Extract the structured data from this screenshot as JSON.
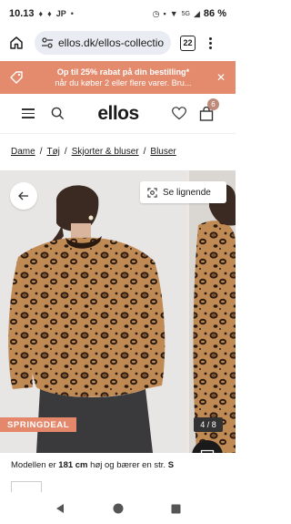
{
  "status": {
    "time": "10.13",
    "carrier": "JP",
    "signal": "5G",
    "battery": "86 %"
  },
  "browser": {
    "url": "ellos.dk/ellos-collectio",
    "tab_count": "22"
  },
  "promo": {
    "line1": "Op til 25% rabat på din bestilling*",
    "line2": "når du køber 2 eller flere varer. Bru..."
  },
  "header": {
    "logo": "ellos",
    "cart_count": "6"
  },
  "breadcrumb": {
    "items": [
      "Dame",
      "Tøj",
      "Skjorter & bluser",
      "Bluser"
    ],
    "separator": "/"
  },
  "gallery": {
    "similar_label": "Se lignende",
    "deal_label": "SPRINGDEAL",
    "counter": "4 / 8"
  },
  "product": {
    "model_prefix": "Modellen er",
    "model_height": "181 cm",
    "model_mid": "høj og bærer en str.",
    "model_size": "S"
  },
  "colors": {
    "promo_bg": "#e48a6d",
    "deal_bg": "#e4876a",
    "badge_bg": "#bf8a7a"
  }
}
